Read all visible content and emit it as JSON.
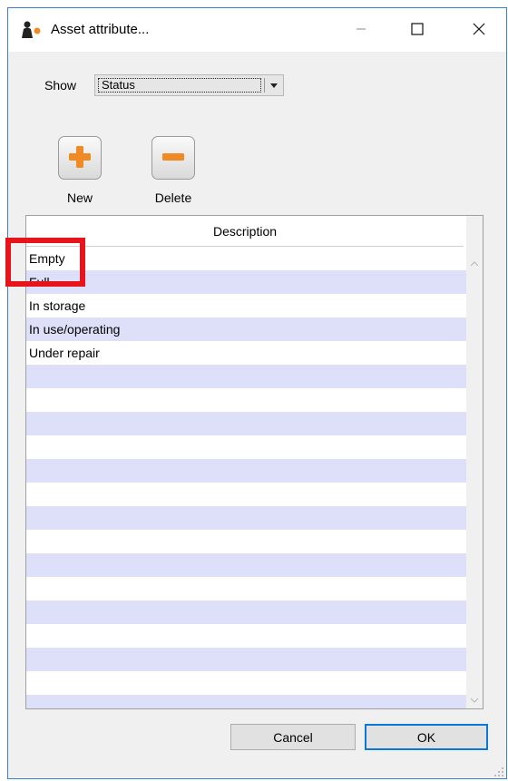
{
  "window": {
    "title": "Asset attribute...",
    "icon": "app-figure-icon"
  },
  "titlebar": {
    "minimize_icon": "minimize-icon",
    "maximize_icon": "maximize-icon",
    "close_icon": "close-icon"
  },
  "filter": {
    "label": "Show",
    "selected": "Status",
    "arrow_icon": "dropdown-arrow-icon"
  },
  "toolbar": {
    "new_label": "New",
    "new_icon": "plus-icon",
    "delete_label": "Delete",
    "delete_icon": "minus-icon"
  },
  "table": {
    "header": "Description",
    "rows": [
      "Empty",
      "Full",
      "In storage",
      "In use/operating",
      "Under repair"
    ]
  },
  "footer": {
    "cancel_label": "Cancel",
    "ok_label": "OK"
  },
  "colors": {
    "row_alt": "#dedff9",
    "highlight": "#e8141c",
    "accent_icon": "#f08a24",
    "window_border": "#3d7fd1"
  }
}
